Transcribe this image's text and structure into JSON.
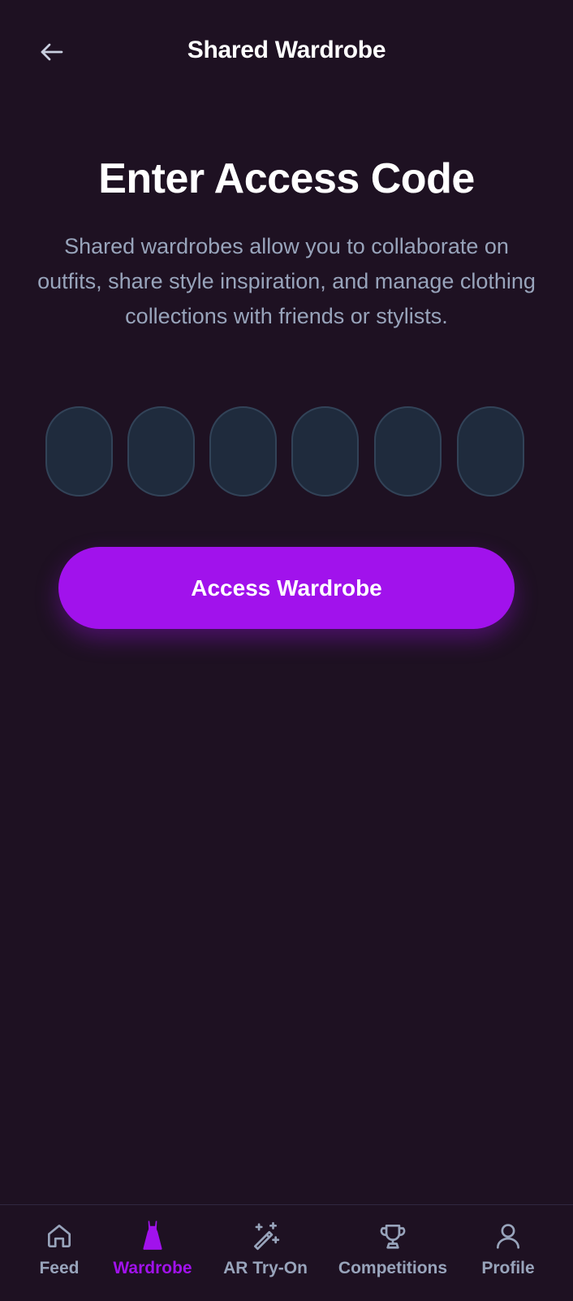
{
  "header": {
    "title": "Shared Wardrobe",
    "back_icon": "arrow-left-icon"
  },
  "main": {
    "title": "Enter Access Code",
    "description": "Shared wardrobes allow you to collaborate on outfits, share style inspiration, and manage clothing collections with friends or stylists.",
    "code_digits": [
      "",
      "",
      "",
      "",
      "",
      ""
    ],
    "submit_label": "Access Wardrobe"
  },
  "nav": {
    "items": [
      {
        "label": "Feed",
        "icon": "home-icon",
        "active": false
      },
      {
        "label": "Wardrobe",
        "icon": "dress-icon",
        "active": true
      },
      {
        "label": "AR Try-On",
        "icon": "magic-wand-icon",
        "active": false
      },
      {
        "label": "Competitions",
        "icon": "trophy-icon",
        "active": false
      },
      {
        "label": "Profile",
        "icon": "user-icon",
        "active": false
      }
    ]
  },
  "colors": {
    "background": "#1e1122",
    "accent": "#a112ec",
    "muted_text": "#98a4bb",
    "input_background": "#1f2b3d",
    "input_border": "#324358"
  }
}
